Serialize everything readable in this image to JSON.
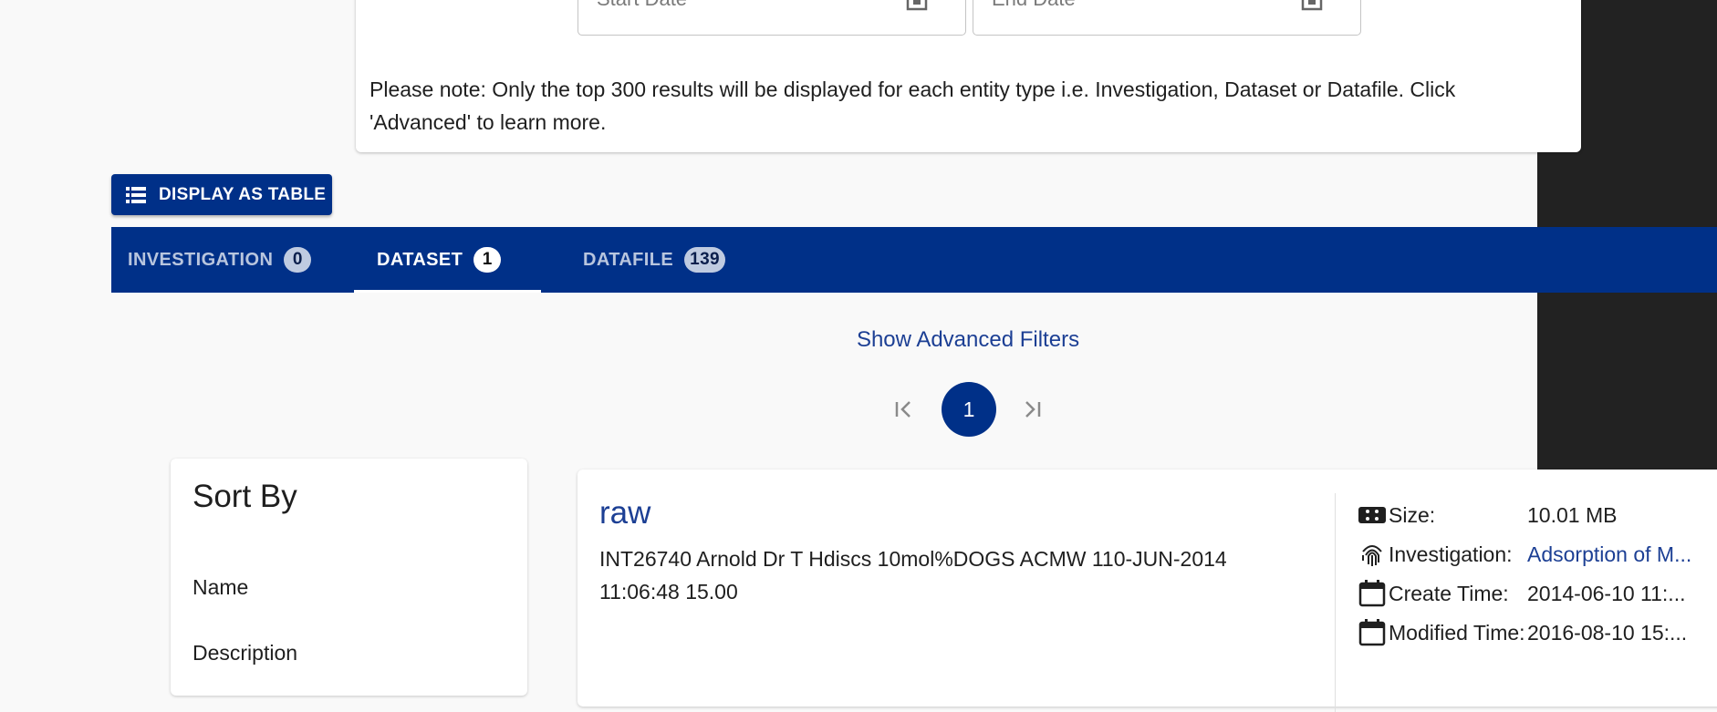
{
  "search": {
    "start_date_placeholder": "Start Date",
    "end_date_placeholder": "End Date",
    "note": "Please note: Only the top 300 results will be displayed for each entity type i.e. Investigation, Dataset or Datafile. Click 'Advanced' to learn more."
  },
  "toolbar": {
    "display_as_table_label": "DISPLAY AS TABLE"
  },
  "tabs": [
    {
      "label": "INVESTIGATION",
      "count": "0",
      "active": false
    },
    {
      "label": "DATASET",
      "count": "1",
      "active": true
    },
    {
      "label": "DATAFILE",
      "count": "139",
      "active": false
    }
  ],
  "filters": {
    "advanced_link": "Show Advanced Filters"
  },
  "pagination": {
    "current_page": "1",
    "first_icon": "first-page-icon",
    "last_icon": "last-page-icon"
  },
  "sort": {
    "title": "Sort By",
    "options": [
      "Name",
      "Description"
    ]
  },
  "result": {
    "title": "raw",
    "description": "INT26740 Arnold Dr T Hdiscs 10mol%DOGS ACMW 110-JUN-2014 11:06:48 15.00",
    "meta": [
      {
        "icon": "size-icon",
        "label": "Size:",
        "value": "10.01 MB",
        "link": false
      },
      {
        "icon": "fingerprint-icon",
        "label": "Investigation:",
        "value": "Adsorption of M...",
        "link": true
      },
      {
        "icon": "calendar-icon",
        "label": "Create Time:",
        "value": "2014-06-10 11:...",
        "link": false
      },
      {
        "icon": "calendar-icon",
        "label": "Modified Time:",
        "value": "2016-08-10 15:...",
        "link": false
      }
    ]
  },
  "colors": {
    "primary": "#003088",
    "link": "#1c3f94",
    "dark_panel": "#222222",
    "background": "#f9f9f9"
  }
}
